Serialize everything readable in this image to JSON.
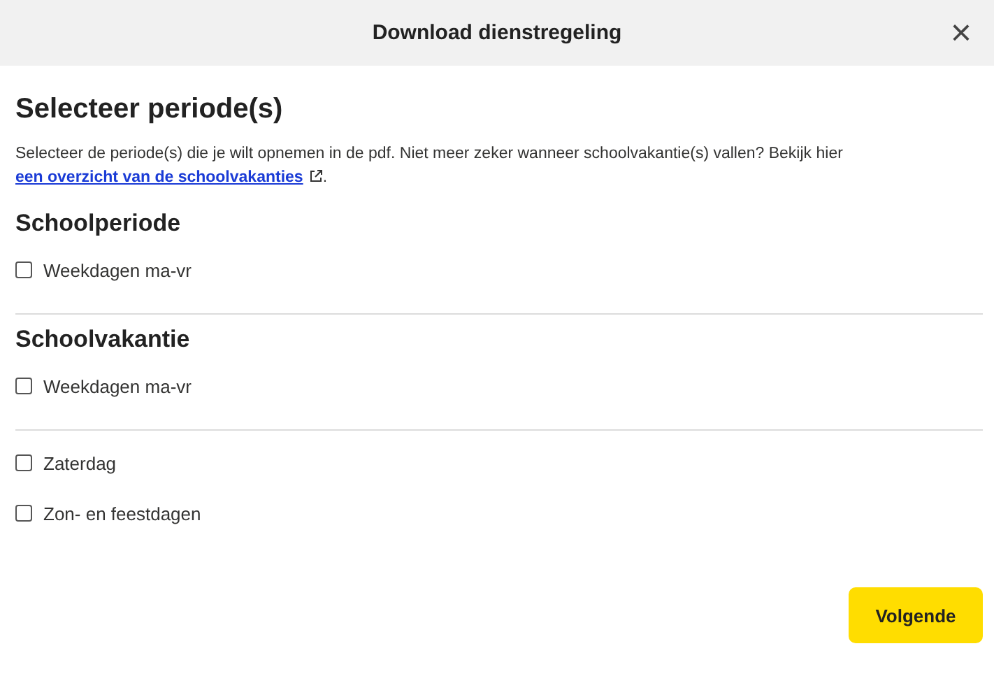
{
  "dialog": {
    "title": "Download dienstregeling",
    "close": "×"
  },
  "heading": "Selecteer periode(s)",
  "intro": {
    "text": "Selecteer de periode(s) die je wilt opnemen in de pdf. Niet meer zeker wanneer schoolvakantie(s) vallen? Bekijk hier",
    "link": "een overzicht van de schoolvakanties",
    "after": "."
  },
  "sections": [
    {
      "title": "Schoolperiode",
      "groups": [
        {
          "options": [
            {
              "label": "Weekdagen ma-vr",
              "checked": false
            }
          ]
        }
      ]
    },
    {
      "title": "Schoolvakantie",
      "groups": [
        {
          "options": [
            {
              "label": "Weekdagen ma-vr",
              "checked": false
            }
          ]
        },
        {
          "options": [
            {
              "label": "Zaterdag",
              "checked": false
            },
            {
              "label": "Zon- en feestdagen",
              "checked": false
            }
          ]
        }
      ]
    }
  ],
  "next_button": "Volgende"
}
